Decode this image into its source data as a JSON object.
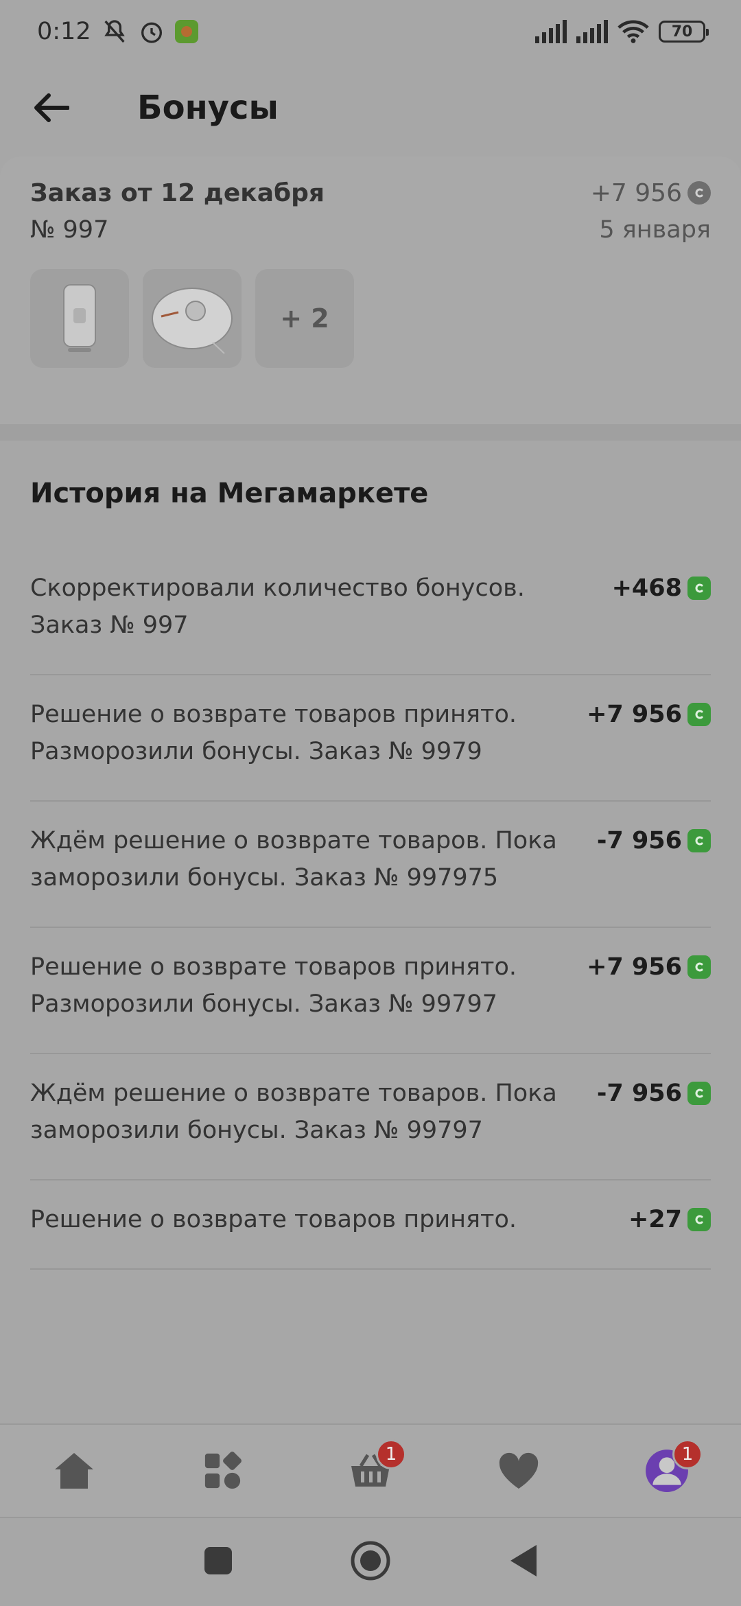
{
  "status_bar": {
    "time": "0:12",
    "battery": "70"
  },
  "header": {
    "title": "Бонусы"
  },
  "order": {
    "title": "Заказ от 12 декабря",
    "number": "№ 997",
    "amount": "+7 956",
    "date": "5 января",
    "extra_count": "+ 2"
  },
  "history": {
    "title": "История на Мегамаркете",
    "items": [
      {
        "text": "Скорректировали количество бонусов. Заказ № 997",
        "amount": "+468"
      },
      {
        "text": "Решение о возврате товаров принято. Разморозили бонусы. Заказ № 9979",
        "amount": "+7 956"
      },
      {
        "text": "Ждём решение о возврате товаров. Пока заморозили бонусы. Заказ № 997975",
        "amount": "-7 956"
      },
      {
        "text": "Решение о возврате товаров принято. Разморозили бонусы. Заказ № 99797",
        "amount": "+7 956"
      },
      {
        "text": "Ждём решение о возврате товаров. Пока заморозили бонусы. Заказ № 99797",
        "amount": "-7 956"
      },
      {
        "text": "Решение о возврате товаров принято.",
        "amount": "+27"
      }
    ]
  },
  "bottom_nav": {
    "cart_badge": "1",
    "profile_badge": "1"
  },
  "colors": {
    "accent_green": "#3c9a3c",
    "badge_red": "#b5302c",
    "profile_purple": "#6b3fb0"
  }
}
